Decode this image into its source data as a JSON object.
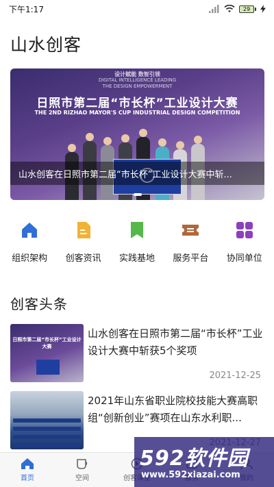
{
  "status_bar": {
    "time": "下午1:17",
    "battery": "29"
  },
  "page": {
    "title": "山水创客"
  },
  "banner": {
    "image_text_top": "设计赋能 数智引领",
    "image_text_top_en1": "DIGITAL INTELLIGENCE LEADING",
    "image_text_top_en2": "THE DESIGN EMPOWERMENT",
    "image_headline": "日照市第二届“市长杯”工业设计大赛",
    "image_sub": "THE 2ND RIZHAO MAYOR'S CUP INDUSTRIAL DESIGN COMPETITION",
    "caption": "山水创客在日照市第二届“市长杯”工业设计大赛中斩..."
  },
  "nav": {
    "items": [
      {
        "label": "组织架构",
        "icon": "home-icon",
        "color": "#2f6fd6"
      },
      {
        "label": "创客资讯",
        "icon": "document-icon",
        "color": "#f2b233"
      },
      {
        "label": "实践基地",
        "icon": "bookmark-icon",
        "color": "#55b84a"
      },
      {
        "label": "服务平台",
        "icon": "ticket-icon",
        "color": "#b0683a"
      },
      {
        "label": "协同单位",
        "icon": "grid-icon",
        "color": "#8c3fbf"
      }
    ]
  },
  "headlines": {
    "title": "创客头条",
    "items": [
      {
        "title": "山水创客在日照市第二届“市长杯”工业设计大赛中斩获5个奖项",
        "date": "2021-12-25",
        "thumb_text": "日照市第二届“市长杯”工业设计大赛"
      },
      {
        "title": "2021年山东省职业院校技能大赛高职组“创新创业”赛项在山东水利职...",
        "date": "2021-12-27"
      }
    ]
  },
  "tabs": {
    "items": [
      {
        "label": "首页",
        "icon": "home-icon",
        "active": true
      },
      {
        "label": "空间",
        "icon": "cup-icon",
        "active": false
      },
      {
        "label": "创客课堂",
        "icon": "play-circle-icon",
        "active": false
      },
      {
        "label": "服务",
        "icon": "service-icon",
        "active": false
      },
      {
        "label": "我的",
        "icon": "user-icon",
        "active": false
      }
    ]
  },
  "watermark": {
    "main": "592软件园",
    "url": "www.592xiazai.com"
  },
  "colors": {
    "accent": "#2f6fd6",
    "text": "#222222",
    "muted": "#888888"
  }
}
